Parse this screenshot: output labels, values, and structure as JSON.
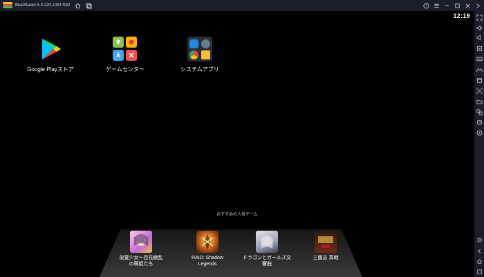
{
  "titlebar": {
    "app_name": "BlueStacks 5.0.220.1003 N32"
  },
  "statusbar": {
    "time": "12:19"
  },
  "home": {
    "apps": [
      {
        "label": "Google Playストア",
        "icon": "google-play-icon"
      },
      {
        "label": "ゲームセンター",
        "icon": "game-center-icon"
      },
      {
        "label": "システムアプリ",
        "icon": "system-apps-folder-icon"
      }
    ]
  },
  "recommended": {
    "title": "おすすめの人気ゲーム",
    "games": [
      {
        "label": "放置少女～百花繚乱\nの萌姫たち"
      },
      {
        "label": "RAID: Shadow\nLegends"
      },
      {
        "label": "ドラゴンとガールズ交\n響曲"
      },
      {
        "label": "三國志 真戦"
      }
    ]
  },
  "colors": {
    "chrome": "#1b1d2b",
    "screen": "#000000",
    "stage_gradient_top": "#161616",
    "stage_gradient_bottom": "#3a3a3a"
  }
}
